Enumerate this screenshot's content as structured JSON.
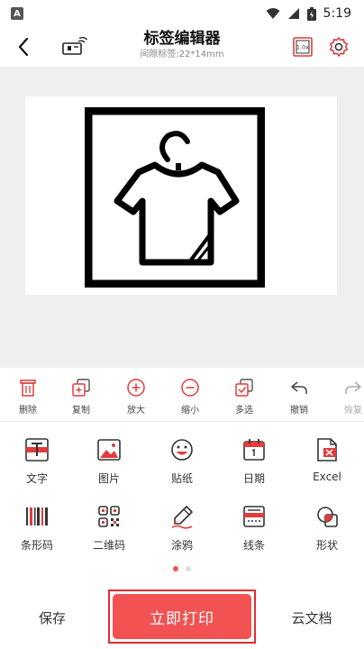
{
  "status_bar": {
    "app_badge": "A",
    "time": "5:19"
  },
  "header": {
    "title": "标签编辑器",
    "subtitle": "间隙标签:22*14mm",
    "scale_badge": "1.0x"
  },
  "toolbar": {
    "items": [
      {
        "label": "删除",
        "icon": "trash-icon"
      },
      {
        "label": "复制",
        "icon": "copy-icon"
      },
      {
        "label": "放大",
        "icon": "zoom-in-icon"
      },
      {
        "label": "缩小",
        "icon": "zoom-out-icon"
      },
      {
        "label": "多选",
        "icon": "multi-select-icon"
      },
      {
        "label": "撤销",
        "icon": "undo-icon"
      },
      {
        "label": "恢复",
        "icon": "redo-icon"
      }
    ]
  },
  "tools": {
    "row1": [
      {
        "label": "文字",
        "icon": "text-icon"
      },
      {
        "label": "图片",
        "icon": "image-icon"
      },
      {
        "label": "贴纸",
        "icon": "sticker-icon"
      },
      {
        "label": "日期",
        "icon": "calendar-icon"
      },
      {
        "label": "Excel",
        "icon": "excel-icon"
      }
    ],
    "row2": [
      {
        "label": "条形码",
        "icon": "barcode-icon"
      },
      {
        "label": "二维码",
        "icon": "qrcode-icon"
      },
      {
        "label": "涂鸦",
        "icon": "doodle-icon"
      },
      {
        "label": "线条",
        "icon": "line-icon"
      },
      {
        "label": "形状",
        "icon": "shape-icon"
      }
    ]
  },
  "pager": {
    "pages": 2,
    "active": 1
  },
  "bottom": {
    "save_label": "保存",
    "print_label": "立即打印",
    "cloud_label": "云文档"
  },
  "colors": {
    "accent": "#f25252",
    "accent_border": "#e02e2e",
    "icon_red": "#e03c3c",
    "canvas_bg": "#efefef"
  }
}
